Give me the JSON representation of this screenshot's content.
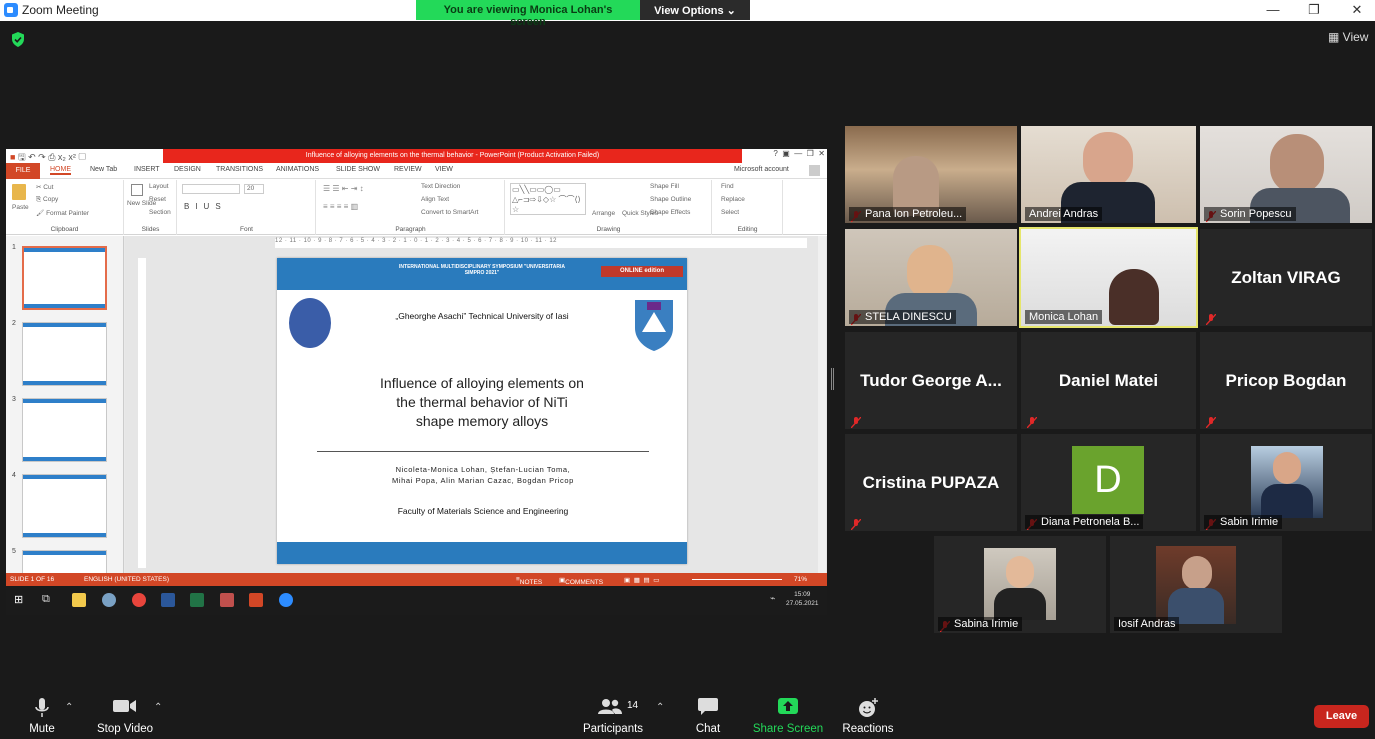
{
  "window": {
    "title": "Zoom Meeting",
    "min": "—",
    "restore": "❐",
    "close": "✕"
  },
  "banner": {
    "message": "You are viewing Monica Lohan's screen",
    "options": "View Options ⌄"
  },
  "view_label": "View",
  "ppt": {
    "title": "Influence of alloying elements on the thermal behavior -  PowerPoint (Product Activation Failed)",
    "tabs": [
      "FILE",
      "HOME",
      "New Tab",
      "INSERT",
      "DESIGN",
      "TRANSITIONS",
      "ANIMATIONS",
      "SLIDE SHOW",
      "REVIEW",
      "VIEW"
    ],
    "account": "Microsoft account",
    "ribbon": {
      "clipboard": {
        "paste": "Paste",
        "cut": "Cut",
        "copy": "Copy",
        "format_painter": "Format Painter",
        "group": "Clipboard"
      },
      "slides": {
        "new_slide": "New Slide",
        "layout": "Layout",
        "reset": "Reset",
        "section": "Section",
        "group": "Slides"
      },
      "font": {
        "size": "20",
        "group": "Font"
      },
      "paragraph": {
        "text_direction": "Text Direction",
        "align_text": "Align Text",
        "smartart": "Convert to SmartArt",
        "group": "Paragraph"
      },
      "drawing": {
        "arrange": "Arrange",
        "quick_styles": "Quick Styles",
        "shape_fill": "Shape Fill",
        "shape_outline": "Shape Outline",
        "shape_effects": "Shape Effects",
        "group": "Drawing"
      },
      "editing": {
        "find": "Find",
        "replace": "Replace",
        "select": "Select",
        "group": "Editing"
      }
    },
    "ruler": "12 · 11 · 10 · 9 · 8 · 7 · 6 · 5 · 4 · 3 · 2 · 1 · 0 · 1 · 2 · 3 · 4 · 5 · 6 · 7 · 8 · 9 · 10 · 11 · 12",
    "slide": {
      "symposium": "INTERNATIONAL MULTIDISCIPLINARY SYMPOSIUM \"UNIVERSITARIA SIMPRO 2021\"",
      "online": "ONLINE edition",
      "university": "„Gheorghe Asachi” Technical University of Iasi",
      "title_l1": "Influence of alloying elements on",
      "title_l2": "the thermal behavior of NiTi",
      "title_l3": "shape memory alloys",
      "authors_l1": "Nicoleta-Monica Lohan, Ștefan-Lucian Toma,",
      "authors_l2": "Mihai Popa, Alin Marian Cazac, Bogdan Pricop",
      "faculty": "Faculty of Materials Science and Engineering"
    },
    "thumb_numbers": [
      "1",
      "2",
      "3",
      "4",
      "5"
    ],
    "status": {
      "slide": "SLIDE 1 OF 16",
      "lang": "ENGLISH (UNITED STATES)",
      "notes": "NOTES",
      "comments": "COMMENTS",
      "zoom": "71%"
    }
  },
  "taskbar": {
    "time": "15:09",
    "date": "27.05.2021"
  },
  "participants": [
    {
      "name": "Pana Ion Petroleu...",
      "muted": true
    },
    {
      "name": "Andrei Andras",
      "muted": false
    },
    {
      "name": "Sorin Popescu",
      "muted": true
    },
    {
      "name": "STELA DINESCU",
      "muted": true
    },
    {
      "name": "Monica Lohan",
      "muted": false
    },
    {
      "name": "Zoltan VIRAG",
      "muted": true
    },
    {
      "name": "Tudor George A...",
      "muted": true
    },
    {
      "name": "Daniel Matei",
      "muted": true
    },
    {
      "name": "Pricop Bogdan",
      "muted": true
    },
    {
      "name": "Cristina PUPAZA",
      "muted": true
    },
    {
      "name": "Diana Petronela B...",
      "muted": true,
      "avatar": "D"
    },
    {
      "name": "Sabin Irimie",
      "muted": true
    },
    {
      "name": "Sabina Irimie",
      "muted": true
    },
    {
      "name": "Iosif Andras",
      "muted": false
    }
  ],
  "toolbar": {
    "mute": "Mute",
    "stop_video": "Stop Video",
    "participants": "Participants",
    "participants_count": "14",
    "chat": "Chat",
    "share_screen": "Share Screen",
    "reactions": "Reactions",
    "leave": "Leave"
  },
  "colors": {
    "accent_green": "#23d959",
    "share_green": "#23d959",
    "leave_red": "#c8261e",
    "ppt_orange": "#d24726",
    "active_border": "#e6e66b"
  }
}
